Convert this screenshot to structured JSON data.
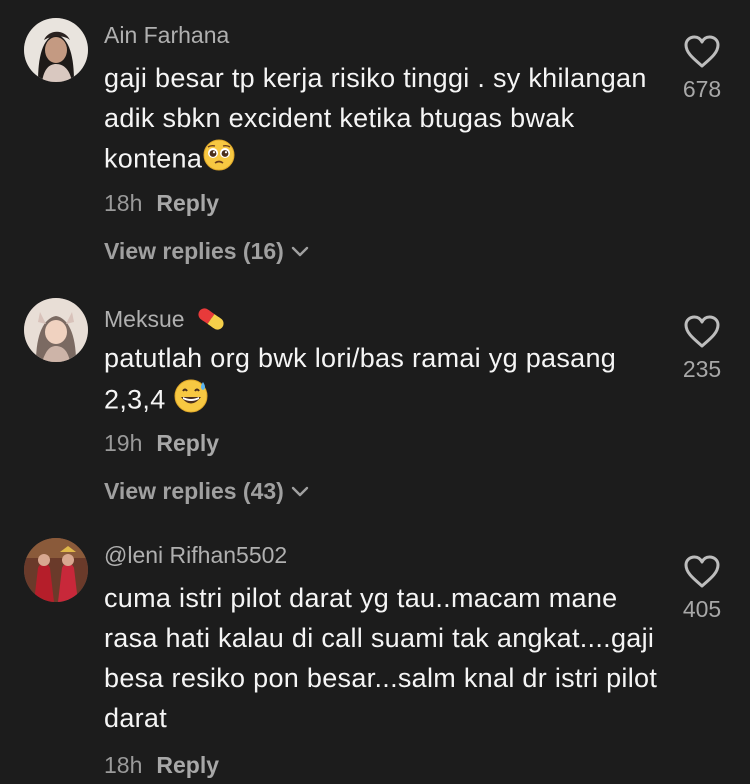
{
  "comments": [
    {
      "username": "Ain Farhana",
      "text": "gaji besar tp kerja risiko tinggi . sy khilangan adik sbkn excident ketika btugas bwak kontena",
      "text_emoji": "pleading-face-emoji",
      "time": "18h",
      "reply_label": "Reply",
      "view_replies": "View replies (16)",
      "likes": "678"
    },
    {
      "username": "Meksue",
      "name_emoji": "pill-emoji",
      "text": "patutlah org bwk lori/bas ramai yg pasang 2,3,4",
      "text_emoji": "grinning-sweat-emoji",
      "time": "19h",
      "reply_label": "Reply",
      "view_replies": "View replies (43)",
      "likes": "235"
    },
    {
      "username": "@leni Rifhan5502",
      "text": "cuma istri pilot darat yg tau..macam mane rasa hati kalau di call suami tak angkat....gaji besa resiko pon besar...salm knal dr istri pilot darat",
      "time": "18h",
      "reply_label": "Reply",
      "likes": "405"
    }
  ],
  "icons": {
    "like": "heart-outline-icon",
    "expand": "chevron-down-icon"
  },
  "colors": {
    "background": "#1c1c1c",
    "primary_text": "#f5f5f5",
    "secondary_text": "#a8a8a8"
  }
}
